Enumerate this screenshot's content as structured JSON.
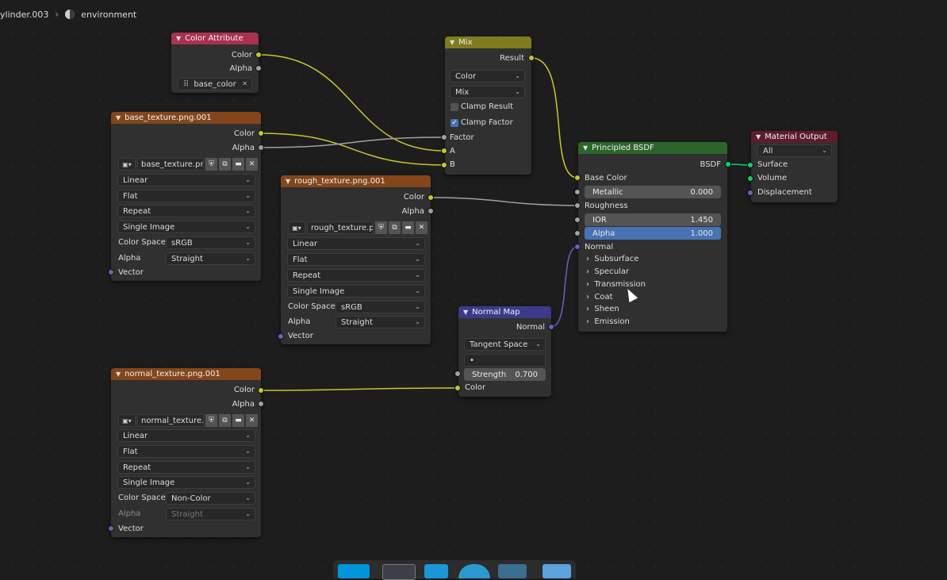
{
  "breadcrumb": {
    "object": "ylinder.003",
    "material": "environment"
  },
  "colors": {
    "attr_header": "#a8324f",
    "texture_header": "#83461b",
    "mix_header": "#7d7d1d",
    "vector_header": "#3b3b8a",
    "shader_header": "#2b652b",
    "output_header": "#5e1d2c",
    "socket_color": "#c7c729",
    "socket_float": "#a1a1a1",
    "socket_vector": "#6363c7",
    "socket_shader": "#00d66b",
    "accent_blue": "#4772b3"
  },
  "color_attribute": {
    "title": "Color Attribute",
    "outputs": [
      "Color",
      "Alpha"
    ],
    "name": "base_color"
  },
  "base_texture": {
    "title": "base_texture.png.001",
    "outputs": [
      "Color",
      "Alpha"
    ],
    "image": "base_texture.pn...",
    "interpolation": "Linear",
    "projection": "Flat",
    "extension": "Repeat",
    "source": "Single Image",
    "color_space_label": "Color Space",
    "color_space": "sRGB",
    "alpha_label": "Alpha",
    "alpha": "Straight",
    "input": "Vector"
  },
  "rough_texture": {
    "title": "rough_texture.png.001",
    "outputs": [
      "Color",
      "Alpha"
    ],
    "image": "rough_texture.pn...",
    "interpolation": "Linear",
    "projection": "Flat",
    "extension": "Repeat",
    "source": "Single Image",
    "color_space_label": "Color Space",
    "color_space": "sRGB",
    "alpha_label": "Alpha",
    "alpha": "Straight",
    "input": "Vector"
  },
  "normal_texture": {
    "title": "normal_texture.png.001",
    "outputs": [
      "Color",
      "Alpha"
    ],
    "image": "normal_texture.p...",
    "interpolation": "Linear",
    "projection": "Flat",
    "extension": "Repeat",
    "source": "Single Image",
    "color_space_label": "Color Space",
    "color_space": "Non-Color",
    "alpha_label": "Alpha",
    "alpha": "Straight",
    "input": "Vector"
  },
  "mix": {
    "title": "Mix",
    "output": "Result",
    "data_type": "Color",
    "blend": "Mix",
    "clamp_result": "Clamp Result",
    "clamp_result_on": false,
    "clamp_factor": "Clamp Factor",
    "clamp_factor_on": true,
    "inputs": [
      "Factor",
      "A",
      "B"
    ]
  },
  "normal_map": {
    "title": "Normal Map",
    "output": "Normal",
    "space": "Tangent Space",
    "uv": "•",
    "strength_label": "Strength",
    "strength": "0.700",
    "input": "Color"
  },
  "bsdf": {
    "title": "Principled BSDF",
    "output": "BSDF",
    "base_color": "Base Color",
    "metallic_label": "Metallic",
    "metallic": "0.000",
    "roughness": "Roughness",
    "ior_label": "IOR",
    "ior": "1.450",
    "alpha_label": "Alpha",
    "alpha": "1.000",
    "normal": "Normal",
    "panels": [
      "Subsurface",
      "Specular",
      "Transmission",
      "Coat",
      "Sheen",
      "Emission"
    ]
  },
  "material_output": {
    "title": "Material Output",
    "target": "All",
    "inputs": [
      "Surface",
      "Volume",
      "Displacement"
    ]
  }
}
